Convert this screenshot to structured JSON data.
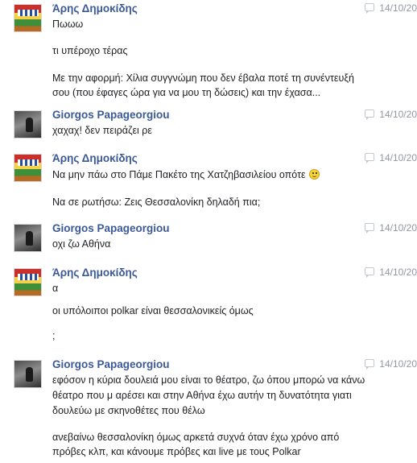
{
  "messages": [
    {
      "author": "Άρης Δημοκίδης",
      "timestamp": "14/10/20",
      "lines": [
        "Πωωω",
        "τι υπέροχο τέρας",
        "Με την αφορμή: Χίλια συγγνώμη που δεν έβαλα ποτέ τη συνέντευξή",
        "σου (που έφαγες ώρα για να μου τη δώσεις) και την έχασα..."
      ]
    },
    {
      "author": "Giorgos Papageorgiou",
      "timestamp": "14/10/20",
      "lines": [
        "χαχαχ! δεν πειράζει ρε"
      ]
    },
    {
      "author": "Άρης Δημοκίδης",
      "timestamp": "14/10/20",
      "lines": [
        "Να μην πάω στο Πάμε Πακέτο της Χατζηβασιλείου οπότε",
        "Να σε ρωτήσω: Ζεις Θεσσαλονίκη δηλαδή πια;"
      ],
      "emoji_icon": "smiley-face"
    },
    {
      "author": "Giorgos Papageorgiou",
      "timestamp": "14/10/20",
      "lines": [
        "οχι ζω Αθήνα"
      ]
    },
    {
      "author": "Άρης Δημοκίδης",
      "timestamp": "14/10/20",
      "lines": [
        "α",
        "οι υπόλοιποι polkar είναι θεσσαλονικείς όμως",
        ";"
      ]
    },
    {
      "author": "Giorgos Papageorgiou",
      "timestamp": "14/10/20",
      "lines": [
        "εφόσον η κύρια δουλειά μου είναι το θέατρο, ζω όπου μπορώ να κάνω",
        "θέατρο που μ αρέσει και στην Αθήνα έχω αυτήν τη δυνατότητα γιατι",
        "δουλεύω με σκηνοθέτες που θέλω",
        "ανεβαίνω θεσσαλονίκη όμως αρκετά συχνά όταν έχω χρόνο από",
        "πρόβες κλπ, και κάνουμε πρόβες και live με τους Polkar"
      ]
    }
  ],
  "colors": {
    "author": "#3b5998",
    "meta": "#9197a3",
    "text": "#1c1e21"
  },
  "icons": {
    "reply": "reply-icon",
    "emoji": "smiley-icon"
  }
}
